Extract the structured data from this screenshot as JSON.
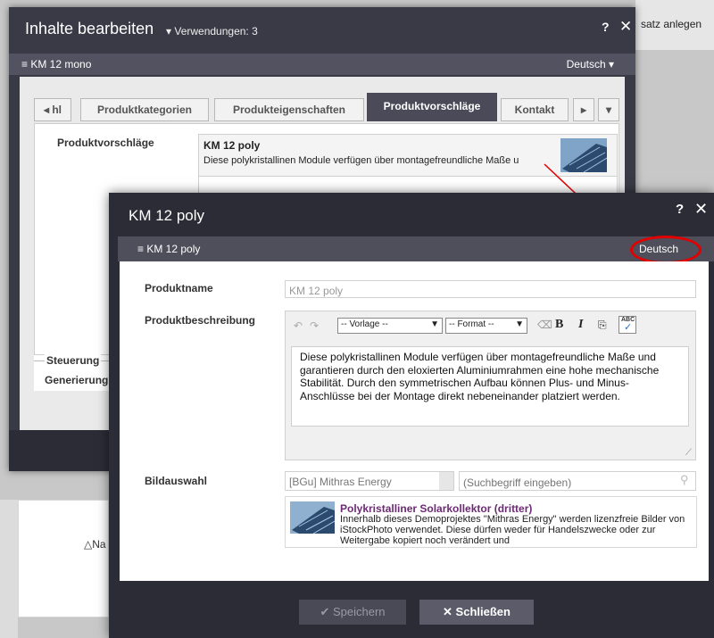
{
  "background": {
    "top_right_text": "satz anlegen",
    "bottom_left_text": "Na"
  },
  "dialog1": {
    "title": "Inhalte bearbeiten",
    "usages": "Verwendungen: 3",
    "help": "?",
    "close": "✕",
    "item_name": "KM 12 mono",
    "language": "Deutsch",
    "tabs": [
      {
        "label": "hl"
      },
      {
        "label": "Produktkategorien"
      },
      {
        "label": "Produkteigenschaften"
      },
      {
        "label": "Produktvorschläge"
      },
      {
        "label": "Kontakt"
      }
    ],
    "field_label": "Produktvorschläge",
    "suggestion": {
      "title": "KM 12 poly",
      "description": "Diese polykristallinen Module verfügen über montagefreundliche Maße u"
    },
    "fieldset_legend": "Steuerung",
    "fieldset_item": "Generierung"
  },
  "dialog2": {
    "title": "KM 12 poly",
    "help": "?",
    "close": "✕",
    "item_name": "KM 12 poly",
    "language": "Deutsch",
    "fields": {
      "name_label": "Produktname",
      "name_value": "KM 12 poly",
      "desc_label": "Produktbeschreibung",
      "desc_text": "Diese polykristallinen Module verfügen über montagefreundliche Maße und garantieren durch den eloxierten Aluminiumrahmen eine hohe mechanische Stabilität. Durch den symmetrischen Aufbau können Plus- und Minus-Anschlüsse bei der Montage direkt nebeneinander platziert werden.",
      "image_label": "Bildauswahl",
      "image_source": "[BGu] Mithras Energy",
      "image_search_placeholder": "(Suchbegriff eingeben)"
    },
    "toolbar": {
      "template_select": "-- Vorlage --",
      "format_select": "-- Format --"
    },
    "image_result": {
      "title": "Polykristalliner Solarkollektor (dritter)",
      "text": "Innerhalb dieses Demoprojektes \"Mithras Energy\" werden lizenzfreie Bilder von iStockPhoto verwendet. Diese dürfen weder für Handelszwecke oder zur Weitergabe kopiert noch verändert und"
    },
    "buttons": {
      "save": "Speichern",
      "close": "Schließen"
    }
  },
  "colors": {
    "dialog_dark": "#2c2c36",
    "active_tab": "#4a4a58",
    "highlight_ring": "#e00000",
    "image_title": "#6d2a74"
  }
}
